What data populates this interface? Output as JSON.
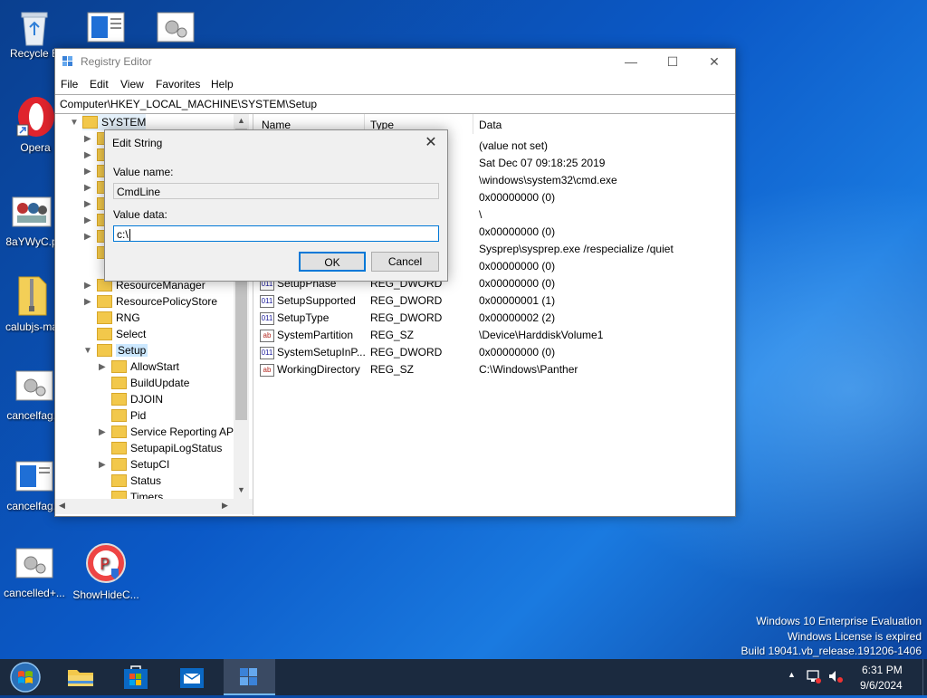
{
  "desktop": {
    "icons": [
      {
        "label": "Recycle Bin",
        "short": "Recycle B"
      },
      {
        "label": "Opera"
      },
      {
        "label": "8aYWyC.p"
      },
      {
        "label": "calubjs-ma"
      },
      {
        "label": "cancelfag..."
      },
      {
        "label": "cancelfag..."
      },
      {
        "label": "cancelled+..."
      },
      {
        "label": "ShowHideC..."
      }
    ],
    "watermark": {
      "line1": "Windows 10 Enterprise Evaluation",
      "line2": "Windows License is expired",
      "line3": "Build 19041.vb_release.191206-1406"
    }
  },
  "window": {
    "title": "Registry Editor",
    "menu": [
      "File",
      "Edit",
      "View",
      "Favorites",
      "Help"
    ],
    "address": "Computer\\HKEY_LOCAL_MACHINE\\SYSTEM\\Setup",
    "tree": {
      "root": "SYSTEM",
      "items": [
        "ResourceManager",
        "ResourcePolicyStore",
        "RNG",
        "Select",
        "Setup"
      ],
      "children": [
        "AllowStart",
        "BuildUpdate",
        "DJOIN",
        "Pid",
        "Service Reporting API",
        "SetupapiLogStatus",
        "SetupCI",
        "Status",
        "Timers"
      ]
    },
    "columns": {
      "name": "Name",
      "type": "Type",
      "data": "Data"
    },
    "values_top": [
      "(value not set)",
      "Sat Dec 07 09:18:25 2019",
      "\\windows\\system32\\cmd.exe",
      "0x00000000 (0)",
      "\\",
      "0x00000000 (0)",
      "Sysprep\\sysprep.exe /respecialize /quiet",
      "0x00000000 (0)"
    ],
    "rows": [
      {
        "name": "SetupPhase",
        "type": "REG_DWORD",
        "data": "0x00000000 (0)",
        "icon": "dword"
      },
      {
        "name": "SetupSupported",
        "type": "REG_DWORD",
        "data": "0x00000001 (1)",
        "icon": "dword"
      },
      {
        "name": "SetupType",
        "type": "REG_DWORD",
        "data": "0x00000002 (2)",
        "icon": "dword"
      },
      {
        "name": "SystemPartition",
        "type": "REG_SZ",
        "data": "\\Device\\HarddiskVolume1",
        "icon": "string"
      },
      {
        "name": "SystemSetupInP...",
        "type": "REG_DWORD",
        "data": "0x00000000 (0)",
        "icon": "dword"
      },
      {
        "name": "WorkingDirectory",
        "type": "REG_SZ",
        "data": "C:\\Windows\\Panther",
        "icon": "string"
      }
    ]
  },
  "dialog": {
    "title": "Edit String",
    "value_name_label": "Value name:",
    "value_name": "CmdLine",
    "value_data_label": "Value data:",
    "value_data": "c:\\",
    "ok": "OK",
    "cancel": "Cancel"
  },
  "taskbar": {
    "time": "6:31 PM",
    "date": "9/6/2024"
  }
}
